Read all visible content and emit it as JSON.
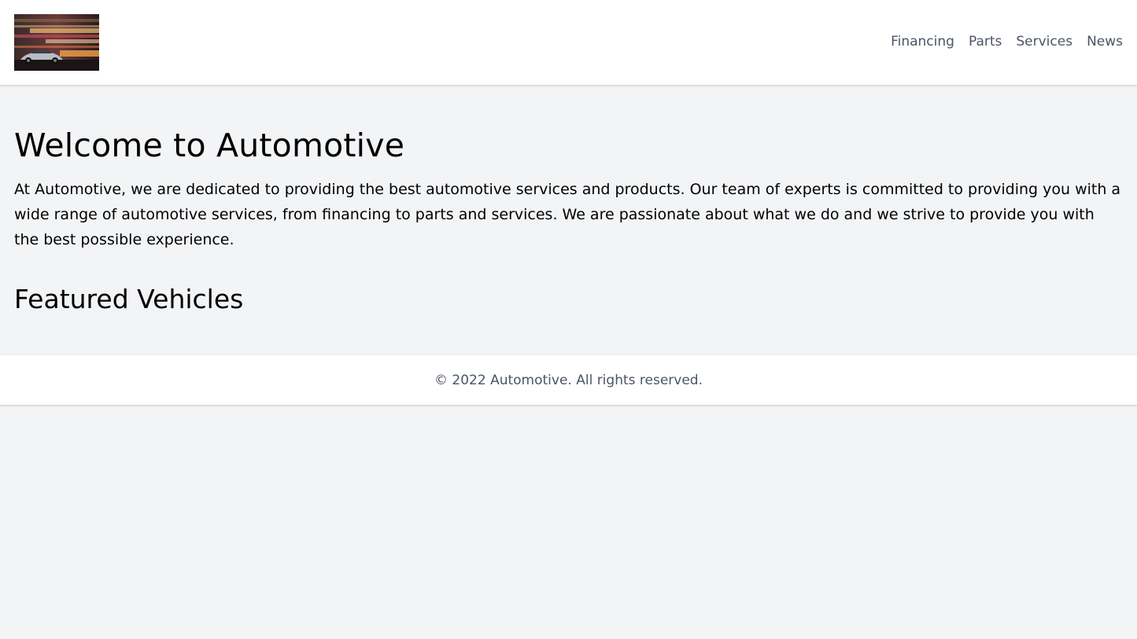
{
  "header": {
    "logo_alt": "Automotive logo",
    "nav": [
      {
        "label": "Financing"
      },
      {
        "label": "Parts"
      },
      {
        "label": "Services"
      },
      {
        "label": "News"
      }
    ]
  },
  "main": {
    "title": "Welcome to Automotive",
    "intro": "At Automotive, we are dedicated to providing the best automotive services and products. Our team of experts is committed to providing you with a wide range of automotive services, from financing to parts and services. We are passionate about what we do and we strive to provide you with the best possible experience.",
    "featured_title": "Featured Vehicles"
  },
  "footer": {
    "text": "© 2022 Automotive. All rights reserved."
  },
  "colors": {
    "page_bg": "#f3f4f6",
    "surface": "#ffffff",
    "nav_text": "#4b5563",
    "body_text": "#000000"
  }
}
